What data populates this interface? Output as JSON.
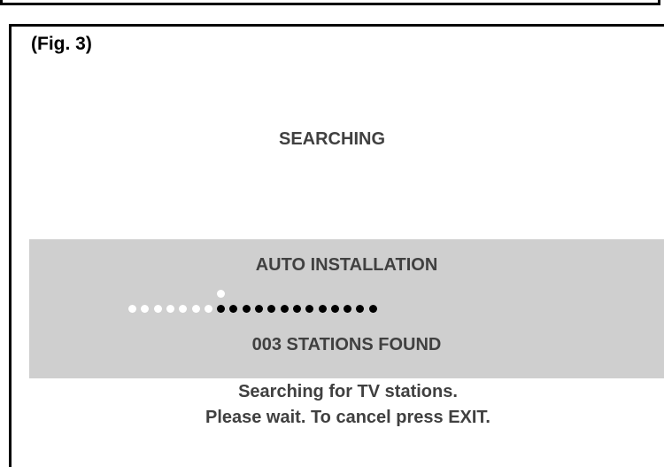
{
  "figure_label": "(Fig. 3)",
  "status_heading": "SEARCHING",
  "panel": {
    "title": "AUTO INSTALLATION",
    "stations_found": "003 STATIONS FOUND",
    "progress": {
      "filled_dots": 7,
      "total_dots": 20,
      "fraction": 0.35
    }
  },
  "help": {
    "line1": "Searching for TV stations.",
    "line2": "Please wait. To cancel press EXIT."
  }
}
